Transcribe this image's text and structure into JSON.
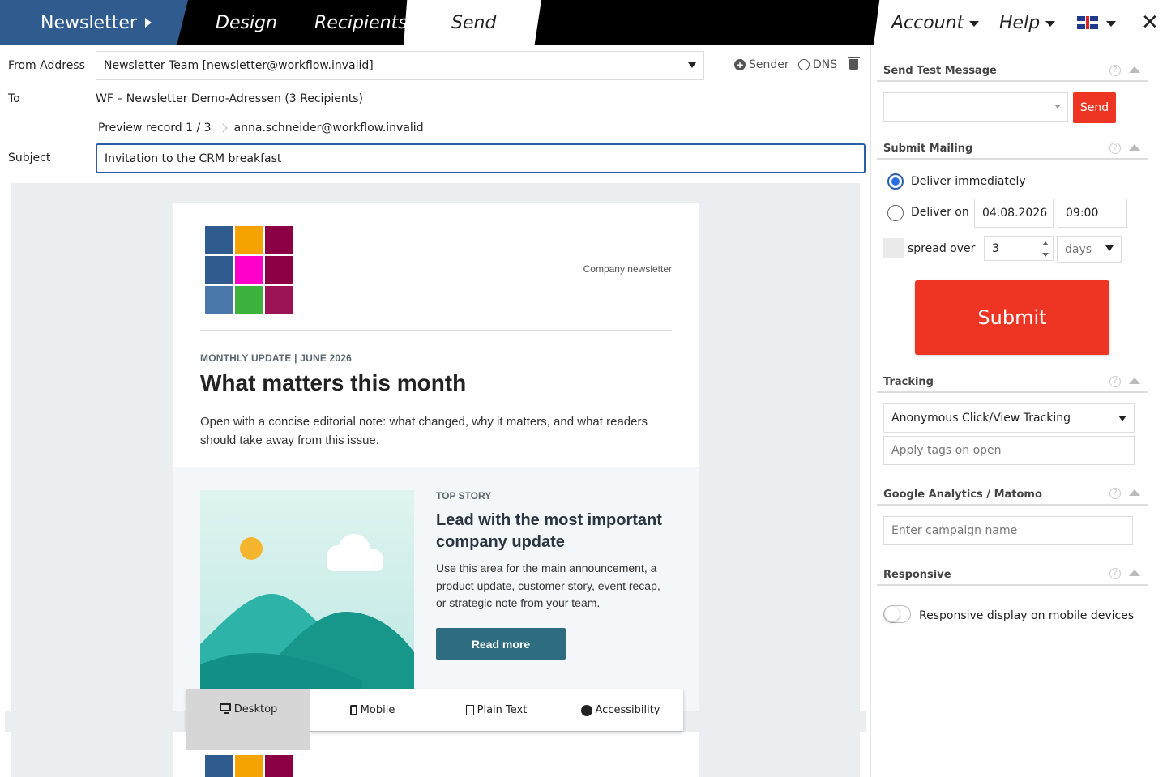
{
  "nav": {
    "newsletter": "Newsletter",
    "design": "Design",
    "recipients": "Recipients",
    "send": "Send",
    "account": "Account",
    "help": "Help",
    "close": "✕"
  },
  "form": {
    "from_label": "From Address",
    "from_value": "Newsletter Team [newsletter@workflow.invalid]",
    "sender_label": "Sender",
    "dns_label": "DNS",
    "to_label": "To",
    "to_value": "WF – Newsletter Demo-Adressen (3 Recipients)",
    "preview_record": "Preview record 1 / 3",
    "preview_email": "anna.schneider@workflow.invalid",
    "subject_label": "Subject",
    "subject_value": "Invitation to the CRM breakfast"
  },
  "email": {
    "company_newsletter": "Company newsletter",
    "kicker": "MONTHLY UPDATE | JUNE 2026",
    "headline": "What matters this month",
    "intro": "Open with a concise editorial note: what changed, why it matters, and what readers should take away from this issue.",
    "story_kicker": "TOP STORY",
    "story_title": "Lead with the most important company update",
    "story_body": "Use this area for the main announcement, a product update, customer story, event recap, or strategic note from your team.",
    "read_more": "Read more",
    "logo_colors": [
      "#2f5b8f",
      "#f5a300",
      "#8b0045",
      "#2f5b8f",
      "#ff00c8",
      "#8b0045",
      "#4a78aa",
      "#3db33d",
      "#9b1255"
    ]
  },
  "view_modes": {
    "desktop": "Desktop",
    "mobile": "Mobile",
    "plain_text": "Plain Text",
    "accessibility": "Accessibility",
    "active": "desktop"
  },
  "panel": {
    "test_title": "Send Test Message",
    "send_button": "Send",
    "submit_title": "Submit Mailing",
    "deliver_immediately": "Deliver immediately",
    "deliver_on": "Deliver on",
    "date_value": "04.08.2026",
    "time_value": "09:00",
    "spread_over": "spread over",
    "spread_value": "3",
    "spread_unit": "days",
    "submit_button": "Submit",
    "tracking_title": "Tracking",
    "tracking_value": "Anonymous Click/View Tracking",
    "tags_placeholder": "Apply tags on open",
    "analytics_title": "Google Analytics / Matomo",
    "campaign_placeholder": "Enter campaign name",
    "responsive_title": "Responsive",
    "responsive_label": "Responsive display on mobile devices",
    "help_glyph": "?"
  },
  "colors": {
    "accent_blue": "#2f5b8f",
    "action_red": "#ee3524",
    "read_more_teal": "#2e6c80"
  }
}
